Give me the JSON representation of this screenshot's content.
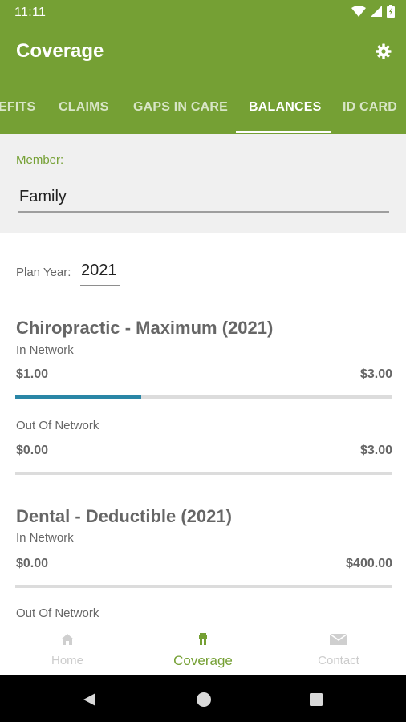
{
  "status_bar": {
    "time": "11:11",
    "icons": [
      "wifi-icon",
      "signal-icon",
      "battery-icon"
    ]
  },
  "app_bar": {
    "title": "Coverage",
    "settings_icon": "gear-icon",
    "background_color": "#75a034"
  },
  "tabs": [
    {
      "label": "EFITS",
      "active": false
    },
    {
      "label": "CLAIMS",
      "active": false
    },
    {
      "label": "GAPS IN CARE",
      "active": false
    },
    {
      "label": "BALANCES",
      "active": true
    },
    {
      "label": "ID CARD",
      "active": false
    }
  ],
  "member": {
    "label": "Member:",
    "value": "Family"
  },
  "plan_year": {
    "label": "Plan Year:",
    "value": "2021"
  },
  "sections": [
    {
      "title": "Chiropractic - Maximum (2021)",
      "in_network": {
        "label": "In Network",
        "used": "$1.00",
        "max": "$3.00",
        "progress": 0.333
      },
      "out_network": {
        "label": "Out Of Network",
        "used": "$0.00",
        "max": "$3.00",
        "progress": 0.0
      }
    },
    {
      "title": "Dental - Deductible (2021)",
      "in_network": {
        "label": "In Network",
        "used": "$0.00",
        "max": "$400.00",
        "progress": 0.0
      },
      "out_network": {
        "label": "Out Of Network"
      }
    }
  ],
  "bottom_nav": [
    {
      "label": "Home",
      "icon": "home-icon",
      "active": false
    },
    {
      "label": "Coverage",
      "icon": "coverage-icon",
      "active": true
    },
    {
      "label": "Contact",
      "icon": "mail-icon",
      "active": false
    }
  ],
  "system_nav": [
    "back-icon",
    "home-circle-icon",
    "recents-icon"
  ],
  "colors": {
    "accent": "#75a034",
    "progress": "#2a86a6"
  }
}
